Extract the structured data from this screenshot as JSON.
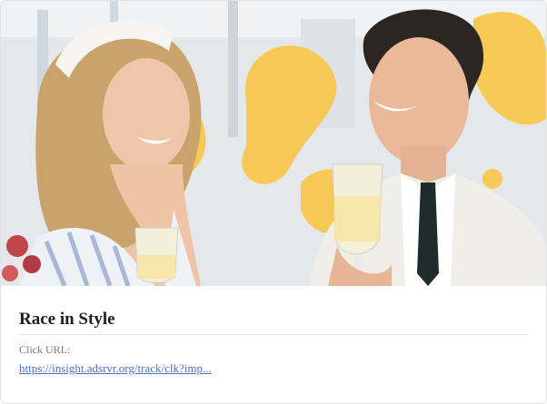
{
  "ad": {
    "image": {
      "description_icon": "photo-couple-raceday",
      "accent_color": "#f6c957"
    },
    "title": "Race in Style",
    "click_url_label": "Click URL:",
    "click_url": "https://insight.adsrvr.org/track/clk?imp..."
  }
}
